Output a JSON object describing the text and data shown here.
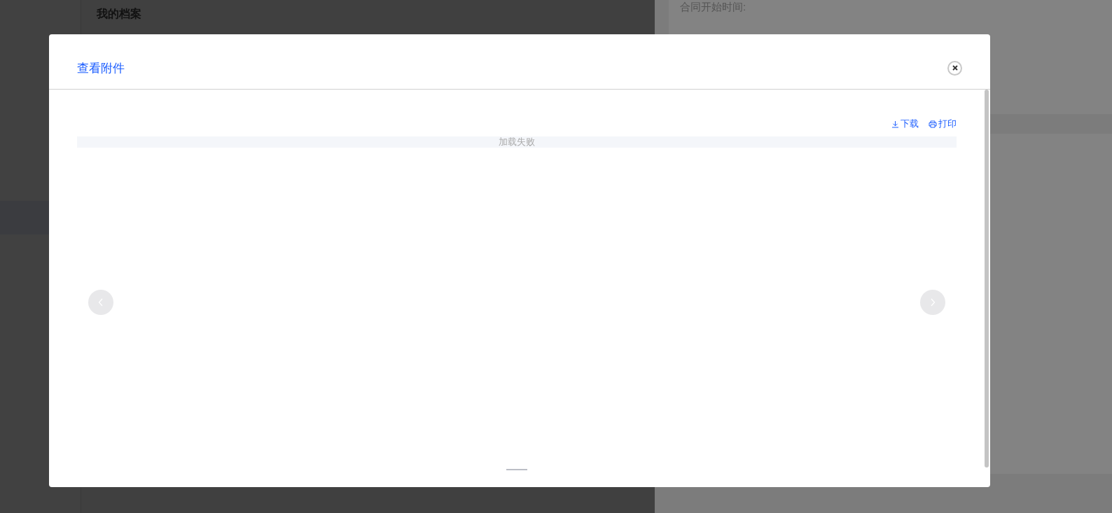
{
  "background": {
    "profile_title": "我的档案",
    "fields": [
      "合同开始时间:"
    ]
  },
  "dialog": {
    "title": "查看附件",
    "actions": [
      {
        "kind": "download",
        "label": "下载"
      },
      {
        "kind": "print",
        "label": "打印"
      }
    ],
    "message": "加载失败"
  }
}
